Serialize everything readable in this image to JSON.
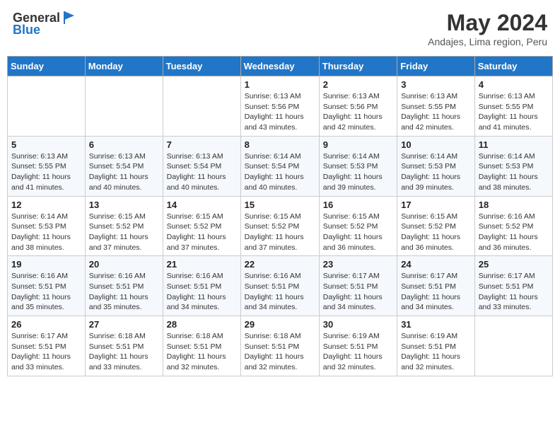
{
  "logo": {
    "line1": "General",
    "line2": "Blue"
  },
  "title": "May 2024",
  "subtitle": "Andajes, Lima region, Peru",
  "days": [
    "Sunday",
    "Monday",
    "Tuesday",
    "Wednesday",
    "Thursday",
    "Friday",
    "Saturday"
  ],
  "weeks": [
    [
      {
        "date": "",
        "sunrise": "",
        "sunset": "",
        "daylight": ""
      },
      {
        "date": "",
        "sunrise": "",
        "sunset": "",
        "daylight": ""
      },
      {
        "date": "",
        "sunrise": "",
        "sunset": "",
        "daylight": ""
      },
      {
        "date": "1",
        "sunrise": "Sunrise: 6:13 AM",
        "sunset": "Sunset: 5:56 PM",
        "daylight": "Daylight: 11 hours and 43 minutes."
      },
      {
        "date": "2",
        "sunrise": "Sunrise: 6:13 AM",
        "sunset": "Sunset: 5:56 PM",
        "daylight": "Daylight: 11 hours and 42 minutes."
      },
      {
        "date": "3",
        "sunrise": "Sunrise: 6:13 AM",
        "sunset": "Sunset: 5:55 PM",
        "daylight": "Daylight: 11 hours and 42 minutes."
      },
      {
        "date": "4",
        "sunrise": "Sunrise: 6:13 AM",
        "sunset": "Sunset: 5:55 PM",
        "daylight": "Daylight: 11 hours and 41 minutes."
      }
    ],
    [
      {
        "date": "5",
        "sunrise": "Sunrise: 6:13 AM",
        "sunset": "Sunset: 5:55 PM",
        "daylight": "Daylight: 11 hours and 41 minutes."
      },
      {
        "date": "6",
        "sunrise": "Sunrise: 6:13 AM",
        "sunset": "Sunset: 5:54 PM",
        "daylight": "Daylight: 11 hours and 40 minutes."
      },
      {
        "date": "7",
        "sunrise": "Sunrise: 6:13 AM",
        "sunset": "Sunset: 5:54 PM",
        "daylight": "Daylight: 11 hours and 40 minutes."
      },
      {
        "date": "8",
        "sunrise": "Sunrise: 6:14 AM",
        "sunset": "Sunset: 5:54 PM",
        "daylight": "Daylight: 11 hours and 40 minutes."
      },
      {
        "date": "9",
        "sunrise": "Sunrise: 6:14 AM",
        "sunset": "Sunset: 5:53 PM",
        "daylight": "Daylight: 11 hours and 39 minutes."
      },
      {
        "date": "10",
        "sunrise": "Sunrise: 6:14 AM",
        "sunset": "Sunset: 5:53 PM",
        "daylight": "Daylight: 11 hours and 39 minutes."
      },
      {
        "date": "11",
        "sunrise": "Sunrise: 6:14 AM",
        "sunset": "Sunset: 5:53 PM",
        "daylight": "Daylight: 11 hours and 38 minutes."
      }
    ],
    [
      {
        "date": "12",
        "sunrise": "Sunrise: 6:14 AM",
        "sunset": "Sunset: 5:53 PM",
        "daylight": "Daylight: 11 hours and 38 minutes."
      },
      {
        "date": "13",
        "sunrise": "Sunrise: 6:15 AM",
        "sunset": "Sunset: 5:52 PM",
        "daylight": "Daylight: 11 hours and 37 minutes."
      },
      {
        "date": "14",
        "sunrise": "Sunrise: 6:15 AM",
        "sunset": "Sunset: 5:52 PM",
        "daylight": "Daylight: 11 hours and 37 minutes."
      },
      {
        "date": "15",
        "sunrise": "Sunrise: 6:15 AM",
        "sunset": "Sunset: 5:52 PM",
        "daylight": "Daylight: 11 hours and 37 minutes."
      },
      {
        "date": "16",
        "sunrise": "Sunrise: 6:15 AM",
        "sunset": "Sunset: 5:52 PM",
        "daylight": "Daylight: 11 hours and 36 minutes."
      },
      {
        "date": "17",
        "sunrise": "Sunrise: 6:15 AM",
        "sunset": "Sunset: 5:52 PM",
        "daylight": "Daylight: 11 hours and 36 minutes."
      },
      {
        "date": "18",
        "sunrise": "Sunrise: 6:16 AM",
        "sunset": "Sunset: 5:52 PM",
        "daylight": "Daylight: 11 hours and 36 minutes."
      }
    ],
    [
      {
        "date": "19",
        "sunrise": "Sunrise: 6:16 AM",
        "sunset": "Sunset: 5:51 PM",
        "daylight": "Daylight: 11 hours and 35 minutes."
      },
      {
        "date": "20",
        "sunrise": "Sunrise: 6:16 AM",
        "sunset": "Sunset: 5:51 PM",
        "daylight": "Daylight: 11 hours and 35 minutes."
      },
      {
        "date": "21",
        "sunrise": "Sunrise: 6:16 AM",
        "sunset": "Sunset: 5:51 PM",
        "daylight": "Daylight: 11 hours and 34 minutes."
      },
      {
        "date": "22",
        "sunrise": "Sunrise: 6:16 AM",
        "sunset": "Sunset: 5:51 PM",
        "daylight": "Daylight: 11 hours and 34 minutes."
      },
      {
        "date": "23",
        "sunrise": "Sunrise: 6:17 AM",
        "sunset": "Sunset: 5:51 PM",
        "daylight": "Daylight: 11 hours and 34 minutes."
      },
      {
        "date": "24",
        "sunrise": "Sunrise: 6:17 AM",
        "sunset": "Sunset: 5:51 PM",
        "daylight": "Daylight: 11 hours and 34 minutes."
      },
      {
        "date": "25",
        "sunrise": "Sunrise: 6:17 AM",
        "sunset": "Sunset: 5:51 PM",
        "daylight": "Daylight: 11 hours and 33 minutes."
      }
    ],
    [
      {
        "date": "26",
        "sunrise": "Sunrise: 6:17 AM",
        "sunset": "Sunset: 5:51 PM",
        "daylight": "Daylight: 11 hours and 33 minutes."
      },
      {
        "date": "27",
        "sunrise": "Sunrise: 6:18 AM",
        "sunset": "Sunset: 5:51 PM",
        "daylight": "Daylight: 11 hours and 33 minutes."
      },
      {
        "date": "28",
        "sunrise": "Sunrise: 6:18 AM",
        "sunset": "Sunset: 5:51 PM",
        "daylight": "Daylight: 11 hours and 32 minutes."
      },
      {
        "date": "29",
        "sunrise": "Sunrise: 6:18 AM",
        "sunset": "Sunset: 5:51 PM",
        "daylight": "Daylight: 11 hours and 32 minutes."
      },
      {
        "date": "30",
        "sunrise": "Sunrise: 6:19 AM",
        "sunset": "Sunset: 5:51 PM",
        "daylight": "Daylight: 11 hours and 32 minutes."
      },
      {
        "date": "31",
        "sunrise": "Sunrise: 6:19 AM",
        "sunset": "Sunset: 5:51 PM",
        "daylight": "Daylight: 11 hours and 32 minutes."
      },
      {
        "date": "",
        "sunrise": "",
        "sunset": "",
        "daylight": ""
      }
    ]
  ]
}
